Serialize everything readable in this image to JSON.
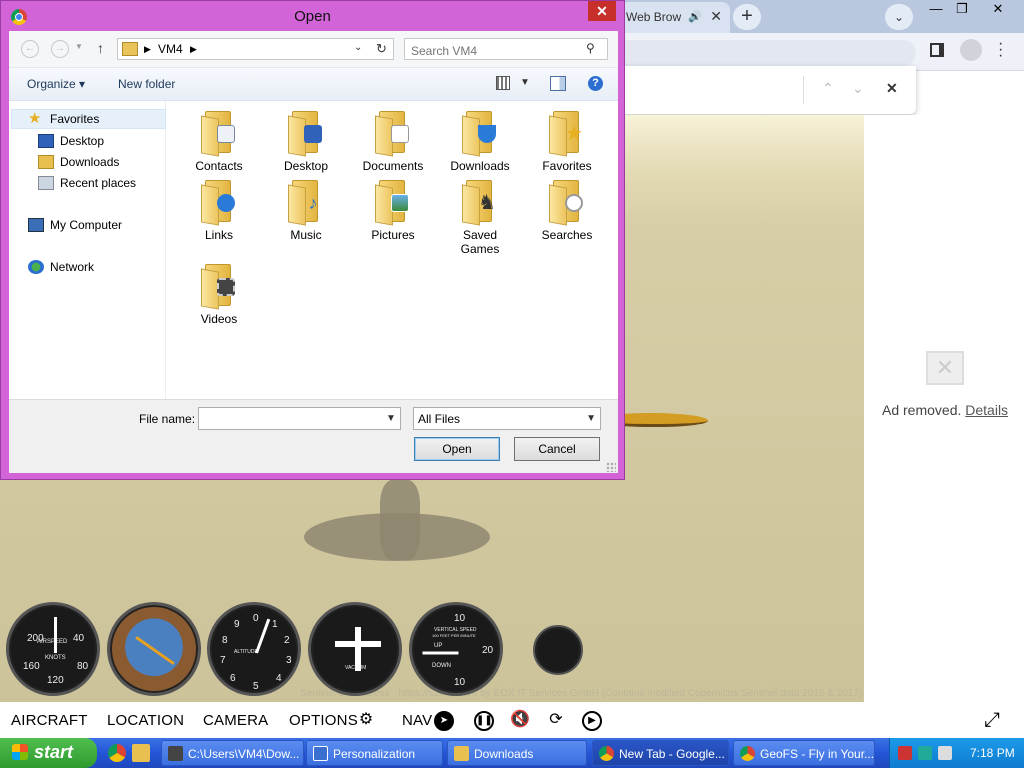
{
  "browser": {
    "tab_title": "Web Brow",
    "tab_speaker": "🔊",
    "tab_close": "✕",
    "new_tab": "+",
    "tab_search": "⌄",
    "window_controls": [
      "—",
      "❐",
      "✕"
    ],
    "find_prev": "⌃",
    "find_next": "⌄",
    "find_close": "✕"
  },
  "ad": {
    "text": "Ad removed.",
    "link": "Details"
  },
  "game": {
    "attribution": "Sentinel-2 cloudless - https://s2maps.eu by EOX IT Services GmbH (Contains modified Copernicus Sentinel data 2016 & 2017)",
    "menu": [
      "AIRCRAFT",
      "LOCATION",
      "CAMERA",
      "OPTIONS",
      "NAV"
    ],
    "gauges": {
      "airspeed_label": "AIRSPEED",
      "airspeed_unit": "KNOTS",
      "airspeed_ticks": [
        "200",
        "40",
        "160",
        "80",
        "120"
      ],
      "altimeter_ticks": [
        "9",
        "0",
        "1",
        "8",
        "2",
        "7",
        "3",
        "6",
        "5",
        "4"
      ],
      "altimeter_label": "ALTITUDE",
      "heading_label": "VACUUM",
      "vsi_label": "VERTICAL SPEED",
      "vsi_sub": "100 FEET PER MINUTE",
      "vsi_ticks": [
        "10",
        "20",
        "10"
      ],
      "vsi_up": "UP",
      "vsi_down": "DOWN"
    }
  },
  "dialog": {
    "title": "Open",
    "close": "✕",
    "address": {
      "crumbs": [
        "VM4"
      ]
    },
    "search_placeholder": "Search VM4",
    "toolbar": {
      "organize": "Organize ▾",
      "new_folder": "New folder",
      "help": "?"
    },
    "nav": {
      "favorites": "Favorites",
      "desktop": "Desktop",
      "downloads": "Downloads",
      "recent": "Recent places",
      "computer": "My Computer",
      "network": "Network"
    },
    "folders": [
      {
        "name": "Contacts"
      },
      {
        "name": "Desktop"
      },
      {
        "name": "Documents"
      },
      {
        "name": "Downloads"
      },
      {
        "name": "Favorites"
      },
      {
        "name": "Links"
      },
      {
        "name": "Music"
      },
      {
        "name": "Pictures"
      },
      {
        "name": "Saved Games"
      },
      {
        "name": "Searches"
      },
      {
        "name": "Videos"
      }
    ],
    "file_name_label": "File name:",
    "file_name_value": "",
    "file_type": "All Files",
    "open_button": "Open",
    "cancel_button": "Cancel"
  },
  "taskbar": {
    "start": "start",
    "tasks": [
      {
        "label": "C:\\Users\\VM4\\Dow...",
        "color": "#444444"
      },
      {
        "label": "Personalization",
        "color": "#3a6fd0"
      },
      {
        "label": "Downloads",
        "color": "#e8c050"
      },
      {
        "label": "New Tab - Google...",
        "color": "#db4437"
      },
      {
        "label": "GeoFS - Fly in Your...",
        "color": "#db4437"
      }
    ],
    "clock": "7:18 PM"
  }
}
